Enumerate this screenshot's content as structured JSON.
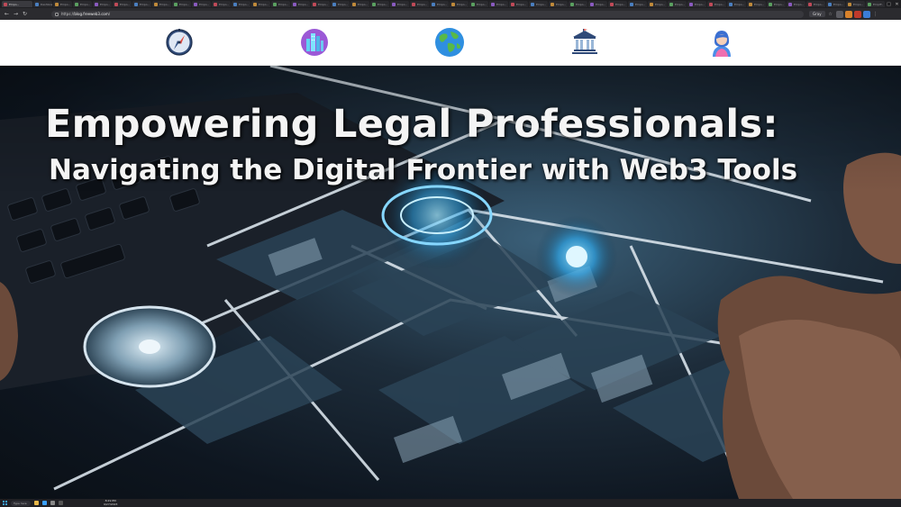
{
  "browser": {
    "tabs": [
      {
        "label": "Empo...",
        "active": true
      },
      {
        "label": "Dashboar..."
      },
      {
        "label": "Empo..."
      },
      {
        "label": "Empo..."
      },
      {
        "label": "Empo..."
      },
      {
        "label": "Empo..."
      },
      {
        "label": "Empo..."
      },
      {
        "label": "Empo..."
      },
      {
        "label": "Empo..."
      },
      {
        "label": "Empo..."
      },
      {
        "label": "Empo..."
      },
      {
        "label": "Empo..."
      },
      {
        "label": "Empo..."
      },
      {
        "label": "Empo..."
      },
      {
        "label": "Empo..."
      },
      {
        "label": "Empo..."
      },
      {
        "label": "Empo..."
      },
      {
        "label": "Empo..."
      },
      {
        "label": "Empo..."
      },
      {
        "label": "Empo..."
      },
      {
        "label": "Empo..."
      },
      {
        "label": "Empo..."
      },
      {
        "label": "Empo..."
      },
      {
        "label": "Empo..."
      },
      {
        "label": "Empo..."
      },
      {
        "label": "Empo..."
      },
      {
        "label": "Empo..."
      },
      {
        "label": "Empo..."
      },
      {
        "label": "Empo..."
      },
      {
        "label": "Empo..."
      },
      {
        "label": "Empo..."
      },
      {
        "label": "Empo..."
      },
      {
        "label": "Empo..."
      },
      {
        "label": "Empo..."
      },
      {
        "label": "Empo..."
      },
      {
        "label": "Empo..."
      },
      {
        "label": "Empo..."
      },
      {
        "label": "Empo..."
      },
      {
        "label": "Empo..."
      },
      {
        "label": "Empo..."
      },
      {
        "label": "Empo..."
      },
      {
        "label": "Empo..."
      },
      {
        "label": "Empo..."
      },
      {
        "label": "Empo..."
      }
    ],
    "url_scheme": "https://",
    "url_host": "blog.freeweb3.com",
    "url_path": "/",
    "pill_label": "Gray"
  },
  "nav": {
    "icons": [
      {
        "name": "compass-icon"
      },
      {
        "name": "city-icon"
      },
      {
        "name": "globe-icon"
      },
      {
        "name": "courthouse-icon"
      },
      {
        "name": "person-icon"
      }
    ]
  },
  "hero": {
    "title_line1": "Empowering Legal Professionals:",
    "title_line2": "Navigating the Digital Frontier with Web3 Tools"
  },
  "taskbar": {
    "search_label": "Type here",
    "time": "8:29 PM",
    "date": "9/27/2023"
  },
  "colors": {
    "accent": "#3ba0ff",
    "headline": "#f4f4f4",
    "nav_bg": "#ffffff"
  }
}
